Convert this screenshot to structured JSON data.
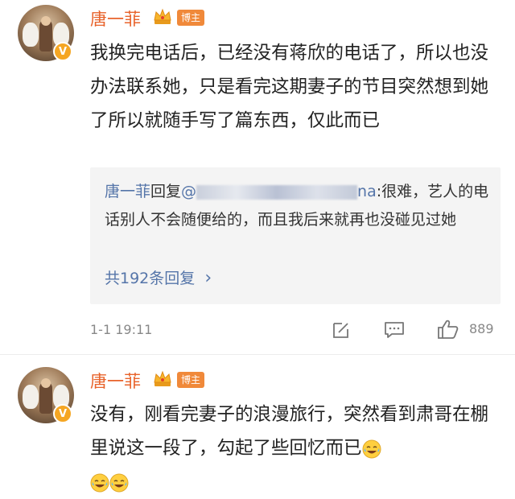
{
  "comments": [
    {
      "username": "唐一菲",
      "owner_tag": "博主",
      "badge": "V",
      "text": "我换完电话后，已经没有蒋欣的电话了，所以也没办法联系她，只是看完这期妻子的节目突然想到她了所以就随手写了篇东西，仅此而已",
      "reply": {
        "user": "唐一菲",
        "verb": "回复",
        "mention_prefix": "@",
        "mention_suffix": "na",
        "text": ":很难，艺人的电话别人不会随便给的，而且我后来就再也没碰见过她"
      },
      "more_replies": "共192条回复",
      "more_chevron": "›",
      "time": "1-1 19:11",
      "likes": "889"
    },
    {
      "username": "唐一菲",
      "owner_tag": "博主",
      "badge": "V",
      "text": "没有，刚看完妻子的浪漫旅行，突然看到肃哥在棚里说这一段了，勾起了些回忆而已"
    }
  ],
  "icons": {
    "edit": "edit-icon",
    "comment": "comment-icon",
    "like": "thumbs-up-icon",
    "crown": "crown-icon",
    "emoji": "laugh-cry-emoji-icon"
  },
  "colors": {
    "username": "#e8632b",
    "link": "#5575a9",
    "tag": "#f0893a",
    "meta": "#888888"
  }
}
